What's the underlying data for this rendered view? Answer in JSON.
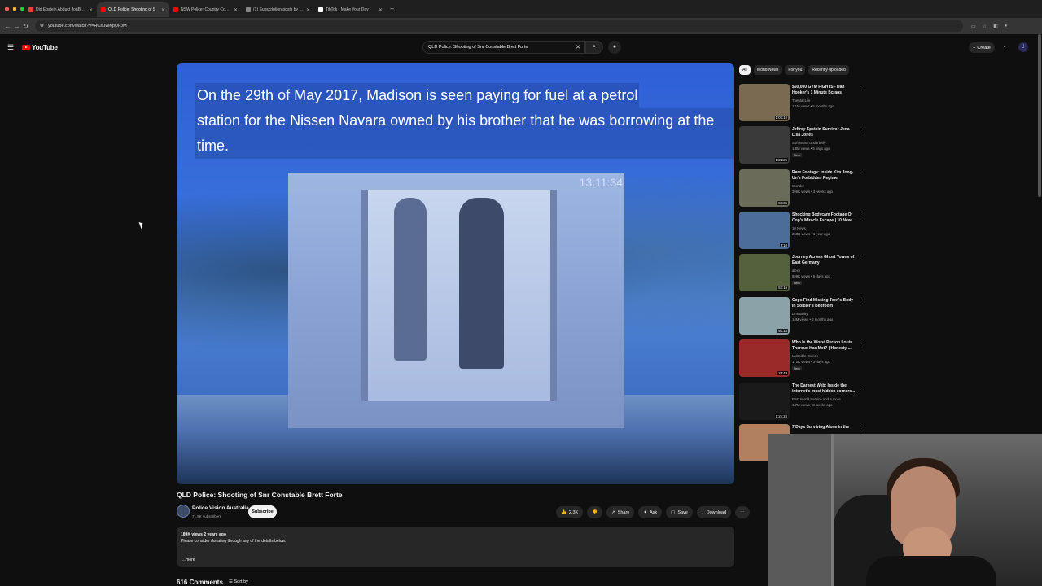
{
  "browser": {
    "tabs": [
      {
        "title": "Did Epstein Abduct JonBenét",
        "color": "#ff3b3b"
      },
      {
        "title": "QLD Police: Shooting of S",
        "color": "#ff0000"
      },
      {
        "title": "NSW Police: Country Cop ki",
        "color": "#ff0000"
      },
      {
        "title": "(1) Subscription posts by Wr",
        "color": "#888888"
      },
      {
        "title": "TikTok - Make Your Day",
        "color": "#ffffff"
      }
    ],
    "new_tab": "+",
    "url": "youtube.com/watch?v=HCsuWKpUFJM"
  },
  "youtube": {
    "logo_text": "YouTube",
    "search_query": "QLD Police: Shooting of Snr Constable Brett Forte",
    "create_label": "Create",
    "avatar_letter": "J"
  },
  "player": {
    "caption_line1": "On the 29th of May 2017, Madison is seen paying for fuel at a petrol",
    "caption_line2": "station for the Nissen Navara owned by his brother that he was borrowing at the time.",
    "timestamp": "13:11:34"
  },
  "video": {
    "title": "QLD Police: Shooting of Snr Constable Brett Forte",
    "channel": "Police Vision Australia",
    "subscribers": "71.5K subscribers",
    "subscribe_label": "Subscribe",
    "likes": "2.3K",
    "share_label": "Share",
    "ask_label": "Ask",
    "save_label": "Save",
    "download_label": "Download",
    "views_date": "189K views  2 years ago",
    "description": "Please consider donating through any of the details below.",
    "more_label": "...more",
    "comments_count": "616 Comments",
    "sort_label": "Sort by"
  },
  "chips": [
    "All",
    "World News",
    "For you",
    "Recently uploaded"
  ],
  "recommendations": [
    {
      "title": "$50,000 GYM FIGHTS - Dan Hooker's 1 Minute Scraps",
      "channel": "TheMacLife",
      "meta": "1.1M views • 5 months ago",
      "duration": "1:07:12",
      "badge": "",
      "thumb": "#7a6a52"
    },
    {
      "title": "Jeffrey Epstein Survivor-Jena Lisa Jones",
      "channel": "Soft White Underbelly",
      "meta": "1.8M views • 5 days ago",
      "duration": "1:22:26",
      "badge": "New",
      "thumb": "#3a3a3a"
    },
    {
      "title": "Rare Footage: Inside Kim Jong-Un's Forbidden Regime",
      "channel": "Wonder",
      "meta": "395K views • 3 weeks ago",
      "duration": "57:35",
      "badge": "",
      "thumb": "#6b6b5a"
    },
    {
      "title": "Shocking Bodycam Footage Of Cop's Miracle Escape | 10 New...",
      "channel": "10 News",
      "meta": "258K views • 1 year ago",
      "duration": "5:10",
      "badge": "",
      "thumb": "#4c6d9a"
    },
    {
      "title": "Journey Across Ghost Towns of East Germany",
      "channel": "alexy",
      "meta": "599K views • 5 days ago",
      "duration": "57:16",
      "badge": "New",
      "thumb": "#55603d"
    },
    {
      "title": "Cops Find Missing Teen's Body In Soldier's Bedroom",
      "channel": "DrInsanity",
      "meta": "14M views • 2 months ago",
      "duration": "40:14",
      "badge": "",
      "thumb": "#8aa2a8"
    },
    {
      "title": "Who Is the Worst Person Louis Theroux Has Met? | Honesty ...",
      "channel": "LADbible Stories",
      "meta": "170K views • 3 days ago",
      "duration": "25:43",
      "badge": "New",
      "thumb": "#9a2a2a"
    },
    {
      "title": "The Darkest Web: Inside the internet's most hidden corners...",
      "channel": "BBC World Service and 2 more",
      "meta": "1.7M views • 3 weeks ago",
      "duration": "1:24:24",
      "badge": "",
      "thumb": "#1a1a1a"
    },
    {
      "title": "7 Days Surviving Alone in the",
      "channel": "",
      "meta": "",
      "duration": "",
      "badge": "",
      "thumb": "#b08060"
    }
  ],
  "icons": {
    "menu": "☰",
    "search": "⌕",
    "mic": "🎤",
    "bell": "🔔",
    "dots": "⋮",
    "close": "✕"
  }
}
